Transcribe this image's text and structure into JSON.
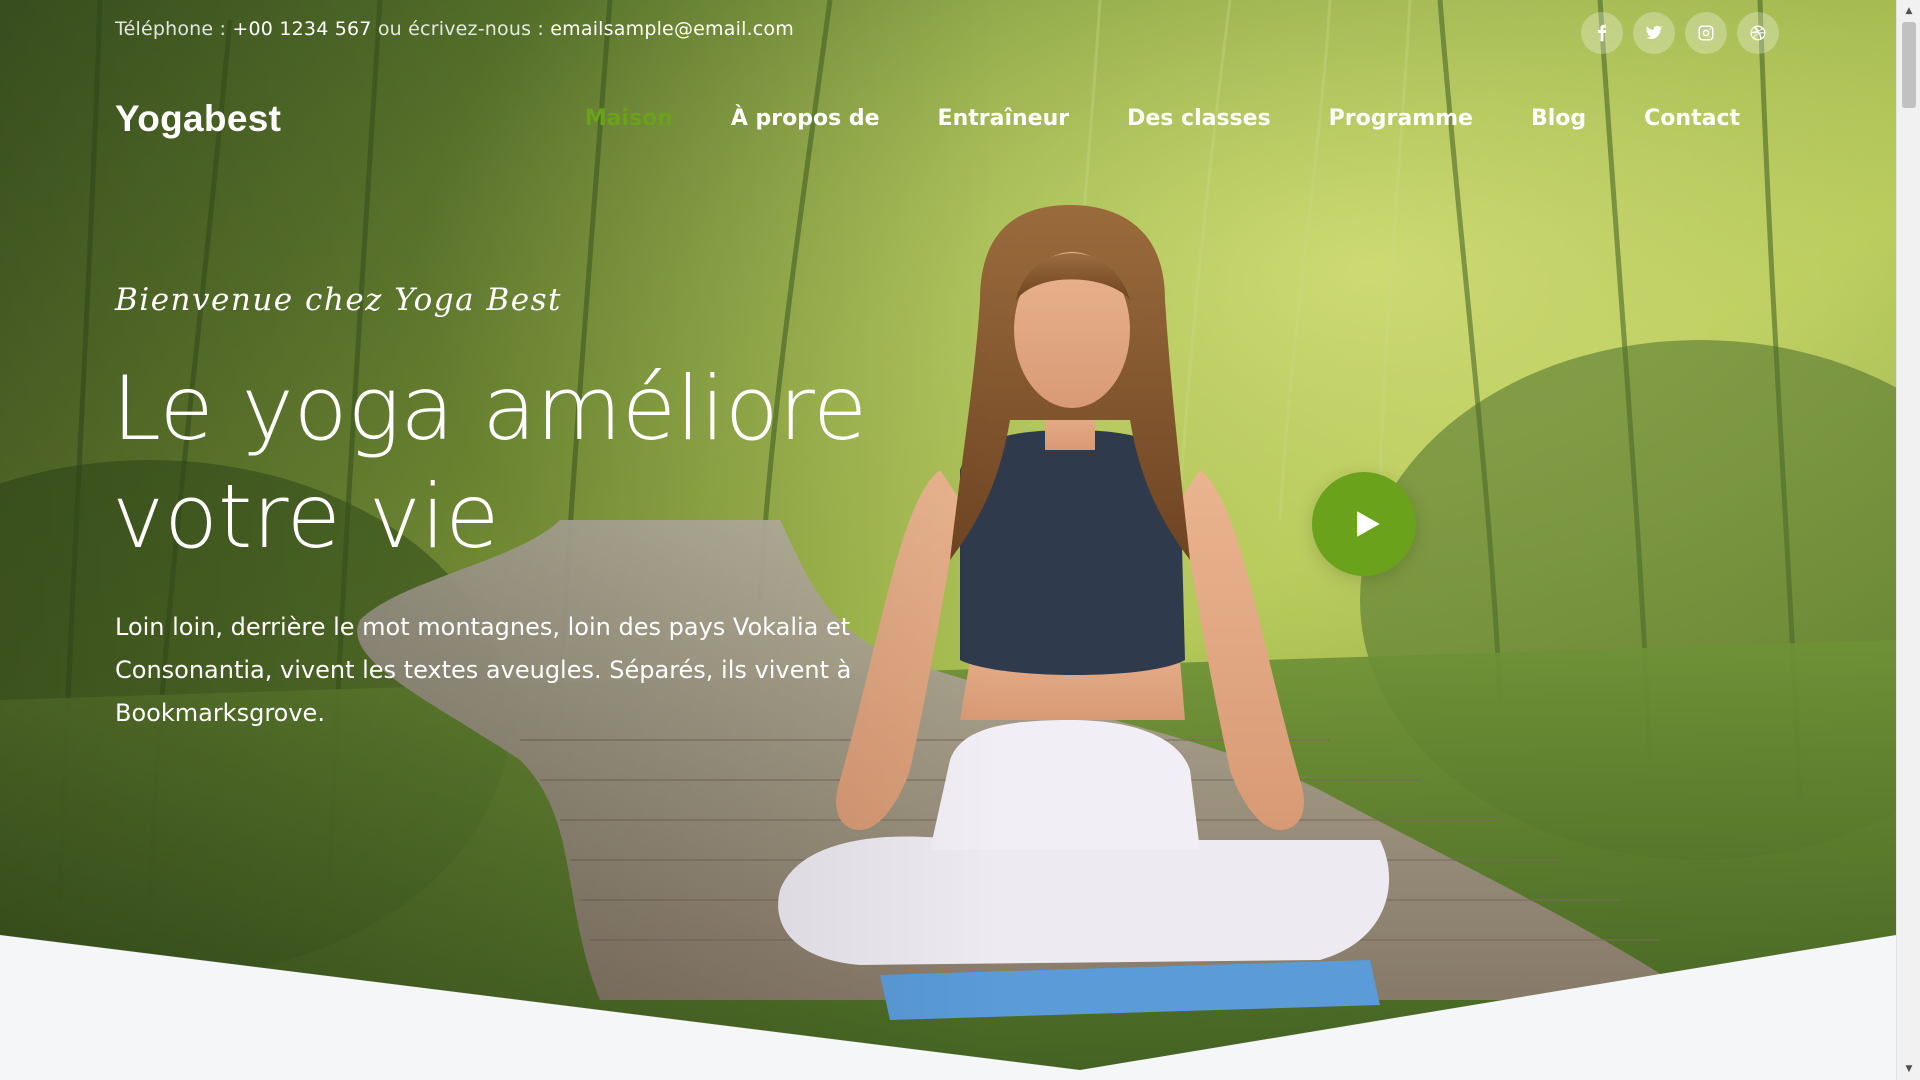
{
  "topbar": {
    "phone_label": "Téléphone :",
    "phone": "+00 1234 567",
    "or_label": "ou",
    "email_label": "écrivez-nous :",
    "email": "emailsample@email.com"
  },
  "socials": [
    {
      "icon": "facebook-icon"
    },
    {
      "icon": "twitter-icon"
    },
    {
      "icon": "instagram-icon"
    },
    {
      "icon": "dribbble-icon"
    }
  ],
  "brand": "Yogabest",
  "nav": {
    "items": [
      {
        "label": "Maison",
        "active": true
      },
      {
        "label": "À propos de",
        "active": false
      },
      {
        "label": "Entraîneur",
        "active": false
      },
      {
        "label": "Des classes",
        "active": false
      },
      {
        "label": "Programme",
        "active": false
      },
      {
        "label": "Blog",
        "active": false
      },
      {
        "label": "Contact",
        "active": false
      }
    ]
  },
  "hero": {
    "script": "Bienvenue chez Yoga Best",
    "headline": "Le yoga améliore votre vie",
    "lead": "Loin loin, derrière le mot montagnes, loin des pays Vokalia et Consonantia, vivent les textes aveugles. Séparés, ils vivent à Bookmarksgrove."
  },
  "play_button": {
    "icon": "play-icon"
  },
  "colors": {
    "accent": "#6aa21c",
    "white": "#ffffff",
    "page_bg": "#f5f6f7"
  }
}
